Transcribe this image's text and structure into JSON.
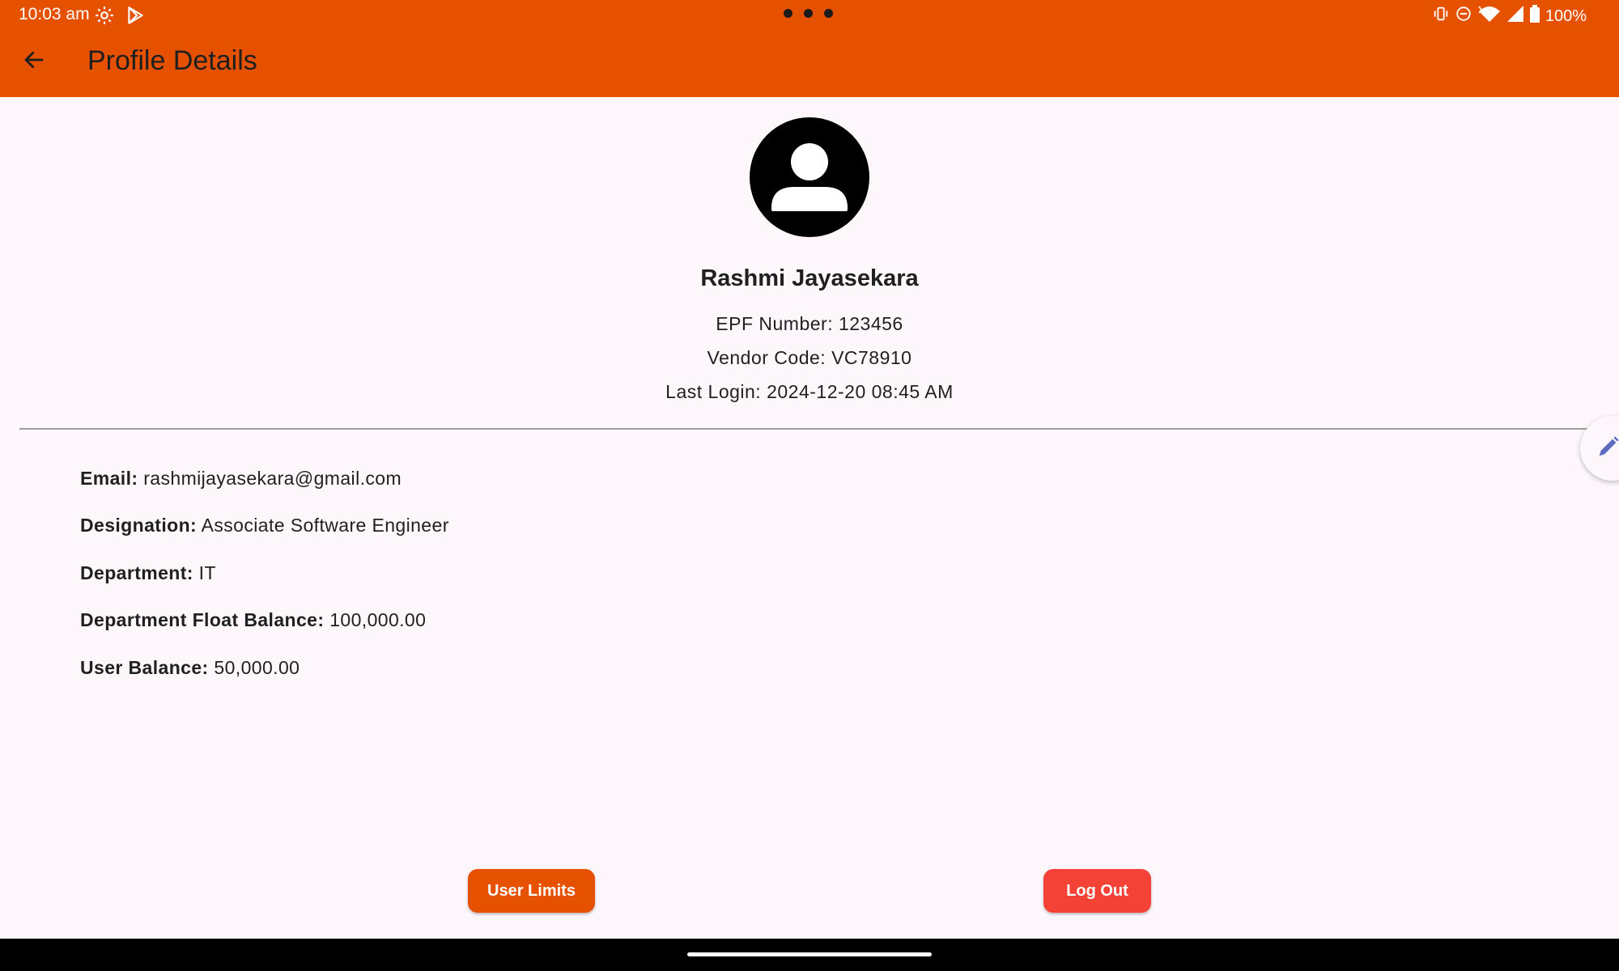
{
  "status_bar": {
    "time": "10:03 am",
    "battery": "100%",
    "icons": [
      "settings-icon",
      "play-store-icon",
      "vibrate-icon",
      "do-not-disturb-icon",
      "wifi-icon",
      "signal-icon",
      "battery-icon"
    ]
  },
  "app_bar": {
    "title": "Profile Details",
    "back_icon": "arrow-back-icon",
    "background": "#E65100"
  },
  "profile": {
    "name": "Rashmi Jayasekara",
    "epf": "EPF Number: 123456",
    "vendor": "Vendor Code: VC78910",
    "last_login": "Last Login: 2024-12-20 08:45 AM",
    "avatar_icon": "person-icon"
  },
  "details": [
    {
      "label": "Email:",
      "value": "rashmijayasekara@gmail.com"
    },
    {
      "label": "Designation:",
      "value": "Associate Software Engineer"
    },
    {
      "label": "Department:",
      "value": "IT"
    },
    {
      "label": "Department Float Balance:",
      "value": "100,000.00"
    },
    {
      "label": "User Balance:",
      "value": "50,000.00"
    }
  ],
  "buttons": {
    "user_limits": "User Limits",
    "log_out": "Log Out"
  },
  "colors": {
    "accent": "#E65100",
    "logout": "#F44336",
    "background": "#FDF7FC",
    "edit_icon": "#5C6BC0"
  },
  "edit_icon": "pencil-icon"
}
